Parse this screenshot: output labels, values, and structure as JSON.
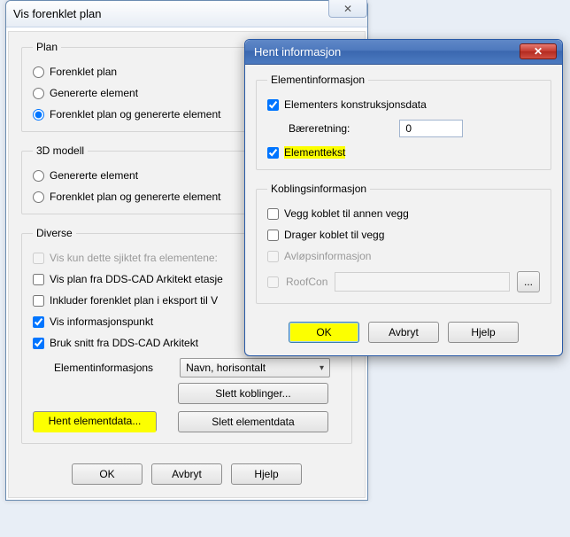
{
  "mainDialog": {
    "title": "Vis forenklet plan",
    "closeGlyph": "✕",
    "plan": {
      "legend": "Plan",
      "opt1": "Forenklet plan",
      "opt2": "Genererte element",
      "opt3": "Forenklet plan og genererte element"
    },
    "model3d": {
      "legend": "3D modell",
      "opt1": "Genererte element",
      "opt2": "Forenklet plan og genererte element"
    },
    "diverse": {
      "legend": "Diverse",
      "chk1": "Vis kun dette sjiktet fra elementene:",
      "chk2": "Vis plan fra DDS-CAD Arkitekt etasje",
      "chk3": "Inkluder forenklet plan i eksport til V",
      "chk4": "Vis informasjonspunkt",
      "chk5": "Bruk snitt fra DDS-CAD Arkitekt",
      "elemInfoLabel": "Elementinformasjons",
      "comboValue": "Navn, horisontalt",
      "btnSlettKobl": "Slett koblinger...",
      "btnHentElem": "Hent elementdata...",
      "btnSlettElem": "Slett elementdata"
    },
    "buttons": {
      "ok": "OK",
      "avbryt": "Avbryt",
      "hjelp": "Hjelp"
    }
  },
  "frontDialog": {
    "title": "Hent informasjon",
    "closeGlyph": "✕",
    "elementInfo": {
      "legend": "Elementinformasjon",
      "chkKon": "Elementers konstruksjonsdata",
      "baereLabel": "Bæreretning:",
      "baereValue": "0",
      "chkTekst": "Elementtekst"
    },
    "koblings": {
      "legend": "Koblingsinformasjon",
      "chkVegg": "Vegg koblet til annen vegg",
      "chkDrager": "Drager koblet til vegg",
      "chkAvlop": "Avløpsinformasjon",
      "chkRoof": "RoofCon",
      "roofBtn": "..."
    },
    "buttons": {
      "ok": "OK",
      "avbryt": "Avbryt",
      "hjelp": "Hjelp"
    }
  }
}
